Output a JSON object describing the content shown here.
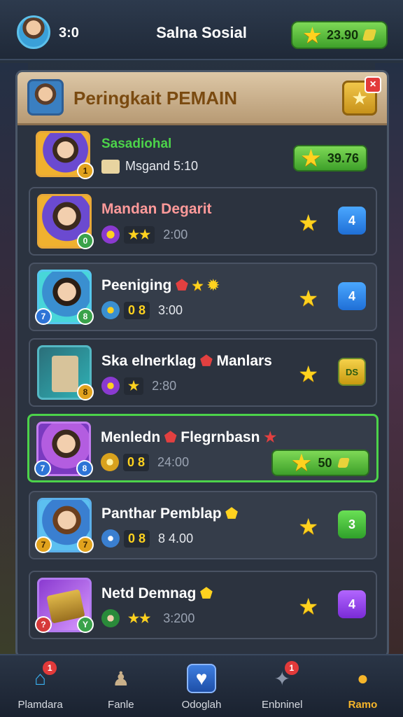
{
  "topbar": {
    "score": "3:0",
    "title": "Salna Sosial",
    "coins": "23.90"
  },
  "panel": {
    "title": "Peringkait PEMAIN",
    "close": "×"
  },
  "top_entry": {
    "name": "Sasadiohal",
    "detail": "Msgand 5:10",
    "points": "39.76",
    "badge": "1"
  },
  "rows": [
    {
      "name": "Mandan Degarit",
      "stats": "★★",
      "time": "2:00",
      "rank": "4",
      "b1": "⚔",
      "b2": "0",
      "color": "#4fe3a0"
    },
    {
      "name": "Peeniging",
      "stats": "0 8",
      "time": "3:00",
      "rank": "4",
      "b1": "7",
      "b2": "8"
    },
    {
      "name": "Ska elnerklag",
      "name2": "Manlars",
      "stats": "★",
      "time": "2:80",
      "rank": "DS",
      "b1": "8"
    },
    {
      "name": "Menledn",
      "name2": "Flegrnbasn",
      "stats": "0 8",
      "time": "24:00",
      "points": "50",
      "b1": "7",
      "b2": "8"
    },
    {
      "name": "Panthar Pemblap",
      "stats": "0 8",
      "time": "8 4.00",
      "rank": "3",
      "b1": "7",
      "b2": "7"
    },
    {
      "name": "Netd Demnag",
      "stats": "★★",
      "time": "3:200",
      "rank": "4",
      "b1": "?",
      "b2": "Y"
    }
  ],
  "nav": [
    {
      "label": "Plamdara",
      "icon": "home-icon",
      "badge": "1"
    },
    {
      "label": "Fanle",
      "icon": "pawn-icon"
    },
    {
      "label": "Odoglah",
      "icon": "shield-heart-icon"
    },
    {
      "label": "Enbninel",
      "icon": "puzzle-icon",
      "badge": "1"
    },
    {
      "label": "Ramo",
      "icon": "speech-icon"
    }
  ]
}
